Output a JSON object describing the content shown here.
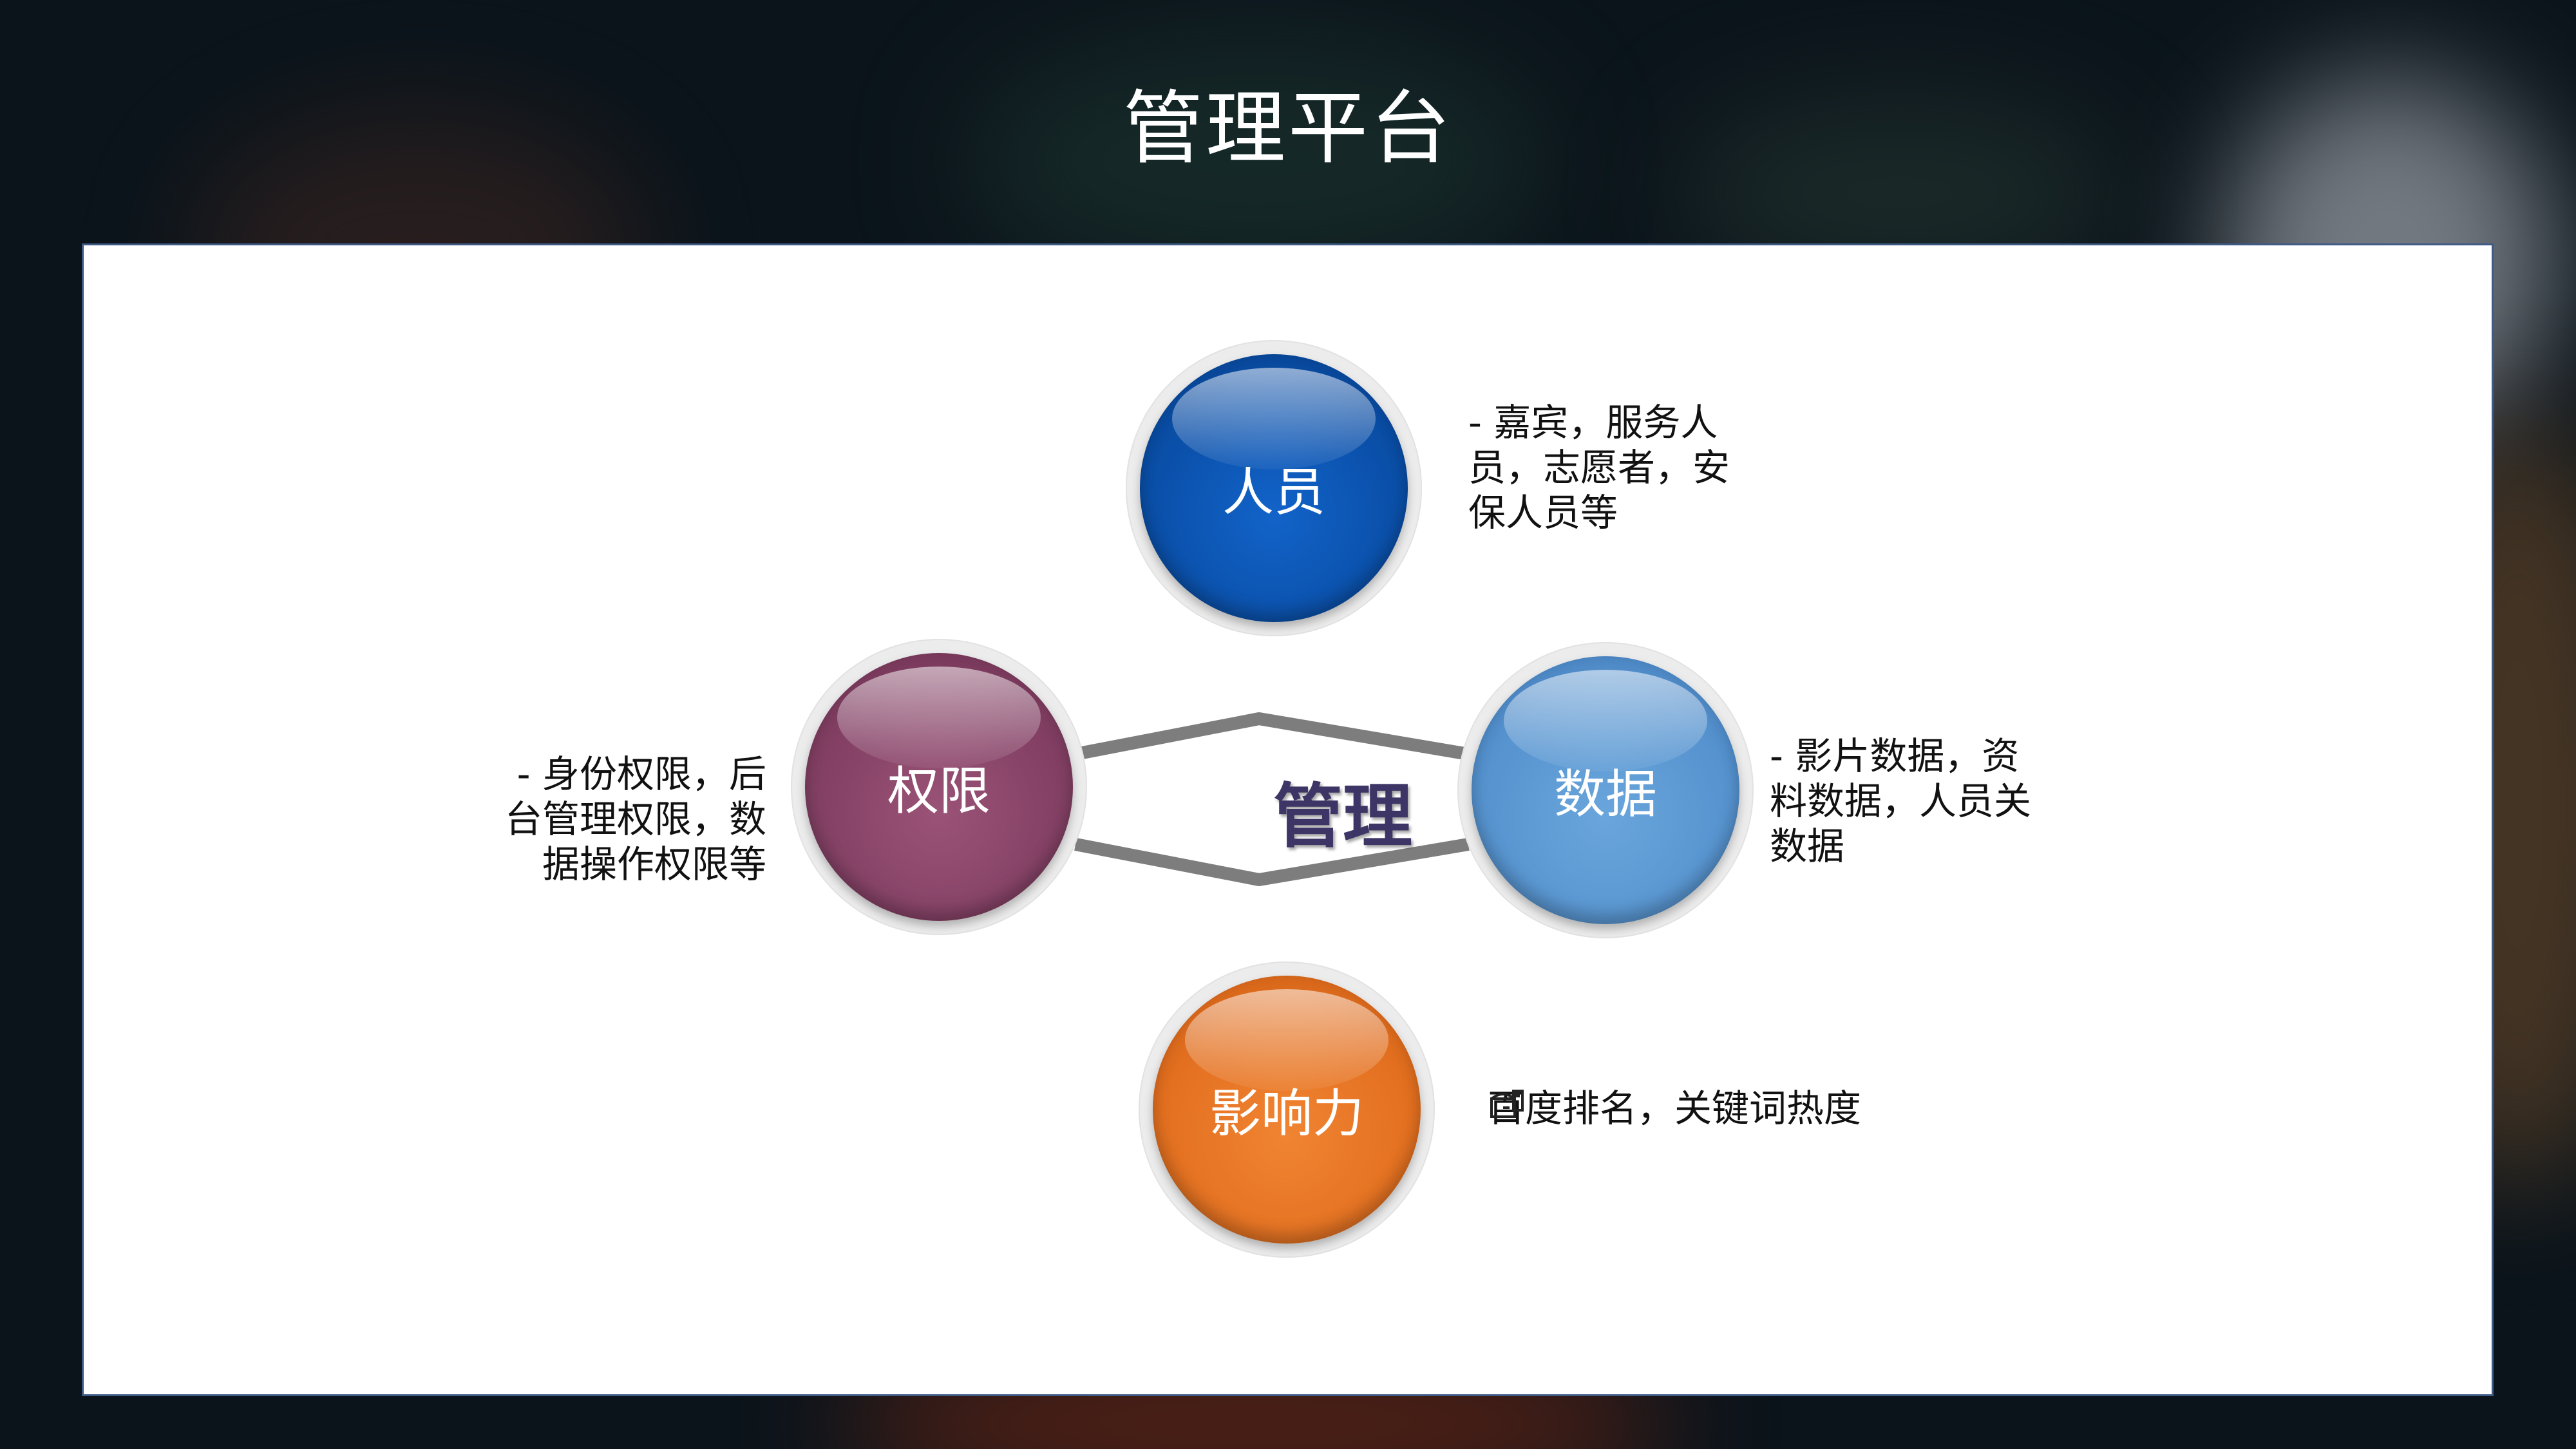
{
  "slide": {
    "title": "管理平台"
  },
  "diagram": {
    "center": "管理",
    "nodes": [
      {
        "id": "personnel",
        "label": "人员",
        "color": "#0a56b8",
        "desc_lines": [
          "- 嘉宾，服务人",
          "员，志愿者，安",
          "保人员等"
        ]
      },
      {
        "id": "permissions",
        "label": "权限",
        "color": "#8a4468",
        "desc_lines": [
          "- 身份权限，后",
          "台管理权限，数",
          "据操作权限等"
        ]
      },
      {
        "id": "data",
        "label": "数据",
        "color": "#5b98d2",
        "desc_lines": [
          "- 影片数据，资",
          "料数据，人员关",
          "数据"
        ]
      },
      {
        "id": "influence",
        "label": "影响力",
        "color": "#e97725",
        "desc_lines": [
          "百度排名，关键词热度"
        ],
        "icon": "mailbox-icon"
      }
    ]
  }
}
